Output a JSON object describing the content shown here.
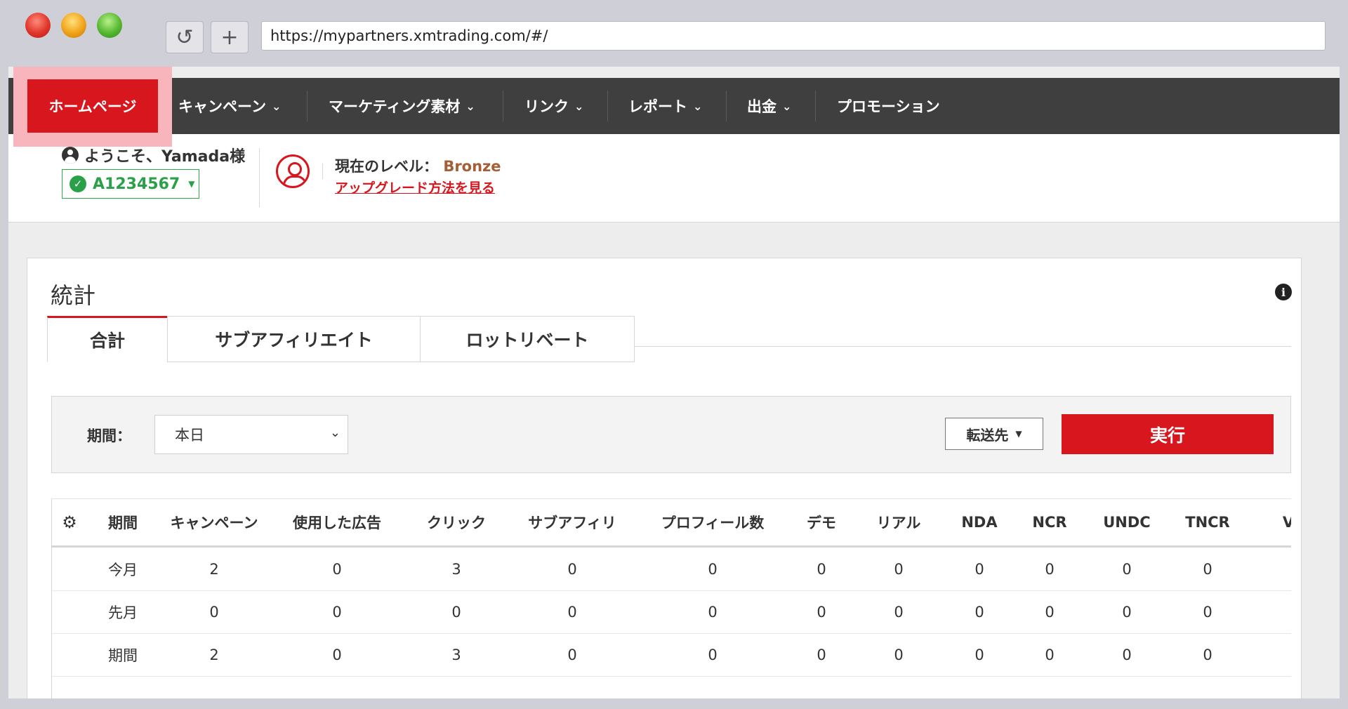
{
  "browser": {
    "url": "https://mypartners.xmtrading.com/#/",
    "reload_glyph": "↺",
    "newtab_glyph": "+"
  },
  "nav": {
    "home": "ホームページ",
    "items": [
      {
        "label": "キャンペーン",
        "chevron": "⌄"
      },
      {
        "label": "マーケティング素材",
        "chevron": "⌄"
      },
      {
        "label": "リンク",
        "chevron": "⌄"
      },
      {
        "label": "レポート",
        "chevron": "⌄"
      },
      {
        "label": "出金",
        "chevron": "⌄"
      },
      {
        "label": "プロモーション",
        "chevron": ""
      }
    ]
  },
  "account": {
    "welcome": "ようこそ、Yamada様",
    "account_id": "A1234567",
    "check_glyph": "✓",
    "caret_glyph": "▼",
    "level_label": "現在のレベル：",
    "level_value": "Bronze",
    "upgrade_link": "アップグレード方法を見る"
  },
  "stats": {
    "title": "統計",
    "info_glyph": "i",
    "tabs": [
      "合計",
      "サブアフィリエイト",
      "ロットリベート"
    ],
    "period_label": "期間：",
    "period_value": "本日",
    "select_caret": "⌄",
    "forward_label": "転送先",
    "forward_caret": "▼",
    "run_label": "実行",
    "table": {
      "gear_glyph": "⚙",
      "headers": [
        "期間",
        "キャンペーン",
        "使用した広告",
        "クリック",
        "サブアフィリ",
        "プロフィール数",
        "デモ",
        "リアル",
        "NDA",
        "NCR",
        "UNDC",
        "TNCR",
        "V"
      ],
      "rows": [
        [
          "今月",
          "2",
          "0",
          "3",
          "0",
          "0",
          "0",
          "0",
          "0",
          "0",
          "0",
          "0"
        ],
        [
          "先月",
          "0",
          "0",
          "0",
          "0",
          "0",
          "0",
          "0",
          "0",
          "0",
          "0",
          "0"
        ],
        [
          "期間",
          "2",
          "0",
          "3",
          "0",
          "0",
          "0",
          "0",
          "0",
          "0",
          "0",
          "0"
        ]
      ]
    }
  },
  "colors": {
    "brand_red": "#d7161e",
    "nav_bg": "#3f3f3f",
    "account_green": "#2aa148",
    "bronze": "#a55f36",
    "highlight": "#f8b5bb"
  }
}
